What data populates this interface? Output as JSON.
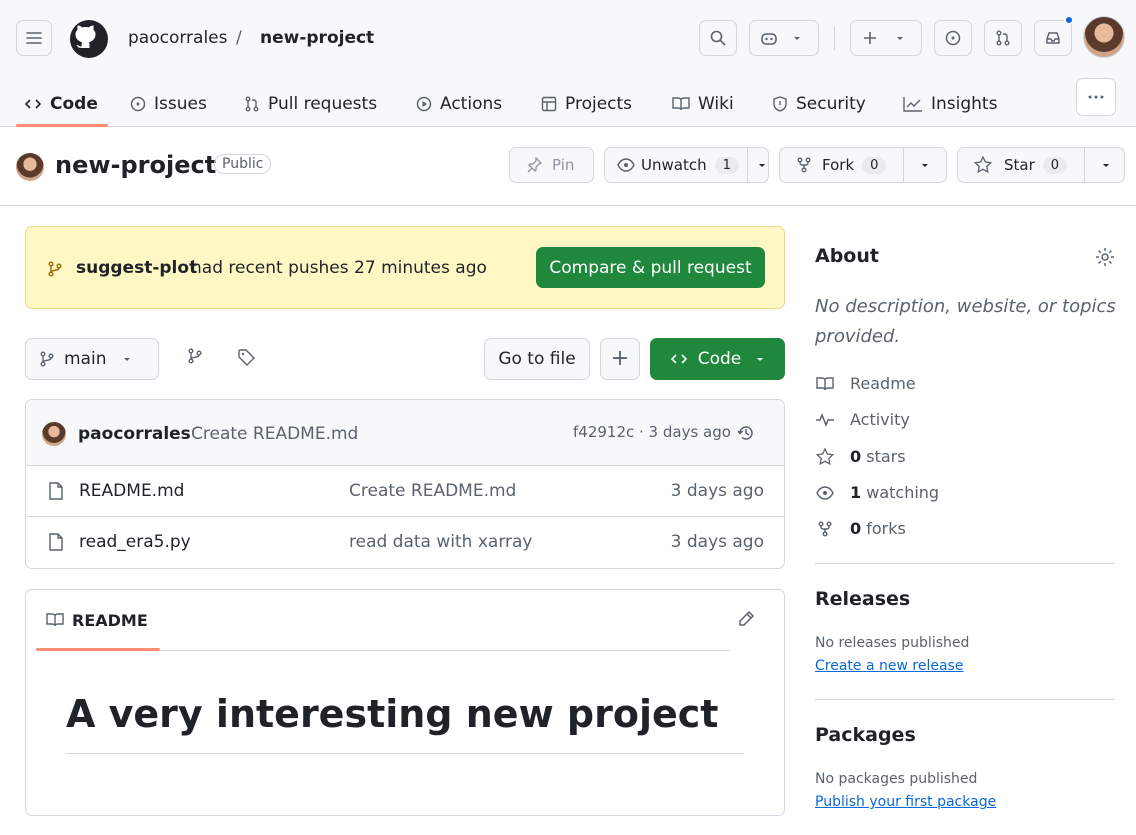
{
  "header": {
    "owner": "paocorrales",
    "separator": "/",
    "repo": "new-project"
  },
  "tabs": [
    {
      "label": "Code",
      "icon": "code-icon"
    },
    {
      "label": "Issues",
      "icon": "issue-icon"
    },
    {
      "label": "Pull requests",
      "icon": "pull-request-icon"
    },
    {
      "label": "Actions",
      "icon": "play-icon"
    },
    {
      "label": "Projects",
      "icon": "table-icon"
    },
    {
      "label": "Wiki",
      "icon": "book-icon"
    },
    {
      "label": "Security",
      "icon": "shield-icon"
    },
    {
      "label": "Insights",
      "icon": "graph-icon"
    }
  ],
  "repo_header": {
    "name": "new-project",
    "visibility": "Public",
    "pin_label": "Pin",
    "watch_label": "Unwatch",
    "watch_count": "1",
    "fork_label": "Fork",
    "fork_count": "0",
    "star_label": "Star",
    "star_count": "0"
  },
  "banner": {
    "branch": "suggest-plot",
    "text": "had recent pushes 27 minutes ago",
    "button": "Compare & pull request"
  },
  "toolbar": {
    "branch": "main",
    "goto_file": "Go to file",
    "add": "+",
    "code": "Code"
  },
  "commit": {
    "author": "paocorrales",
    "message": "Create README.md",
    "meta": "f42912c · 3 days ago"
  },
  "files": [
    {
      "name": "README.md",
      "message": "Create README.md",
      "time": "3 days ago"
    },
    {
      "name": "read_era5.py",
      "message": "read data with xarray",
      "time": "3 days ago"
    }
  ],
  "readme": {
    "tab": "README",
    "heading": "A very interesting new project"
  },
  "about": {
    "title": "About",
    "description": "No description, website, or topics provided.",
    "readme": "Readme",
    "activity": "Activity",
    "stars_n": "0",
    "stars": "stars",
    "watching_n": "1",
    "watching": "watching",
    "forks_n": "0",
    "forks": "forks"
  },
  "releases": {
    "title": "Releases",
    "text": "No releases published",
    "link": "Create a new release"
  },
  "packages": {
    "title": "Packages",
    "text": "No packages published",
    "link": "Publish your first package"
  },
  "colors": {
    "accent_green": "#1f883d",
    "link": "#0969da",
    "tab_underline": "#fd8c73",
    "banner_bg": "#fff8c5"
  }
}
